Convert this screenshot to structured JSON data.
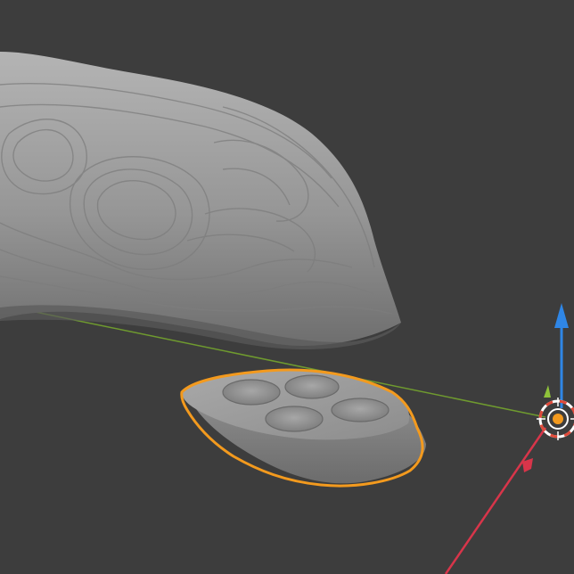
{
  "viewport": {
    "mode": "3d-viewport",
    "background_color": "#3d3d3d"
  },
  "scene": {
    "objects": [
      {
        "name": "sculpted-rock-mesh",
        "selected": false,
        "surface_color": "#8e8e8e"
      },
      {
        "name": "four-hole-base-mesh",
        "selected": true,
        "outline_color": "#f39a1e",
        "hole_count": 4
      }
    ],
    "x_axis_line_color": "#6f9a2f",
    "transform_gizmo": {
      "type": "move",
      "z_axis_color": "#2f86e6",
      "y_axis_color": "#8fc23a",
      "x_axis_color": "#d8354a"
    },
    "cursor_3d": {
      "primary_color": "#ffffff",
      "secondary_color": "#e04a3a"
    }
  },
  "icons": {
    "gizmo": "transform-gizmo-icon",
    "cursor": "3d-cursor-icon"
  }
}
